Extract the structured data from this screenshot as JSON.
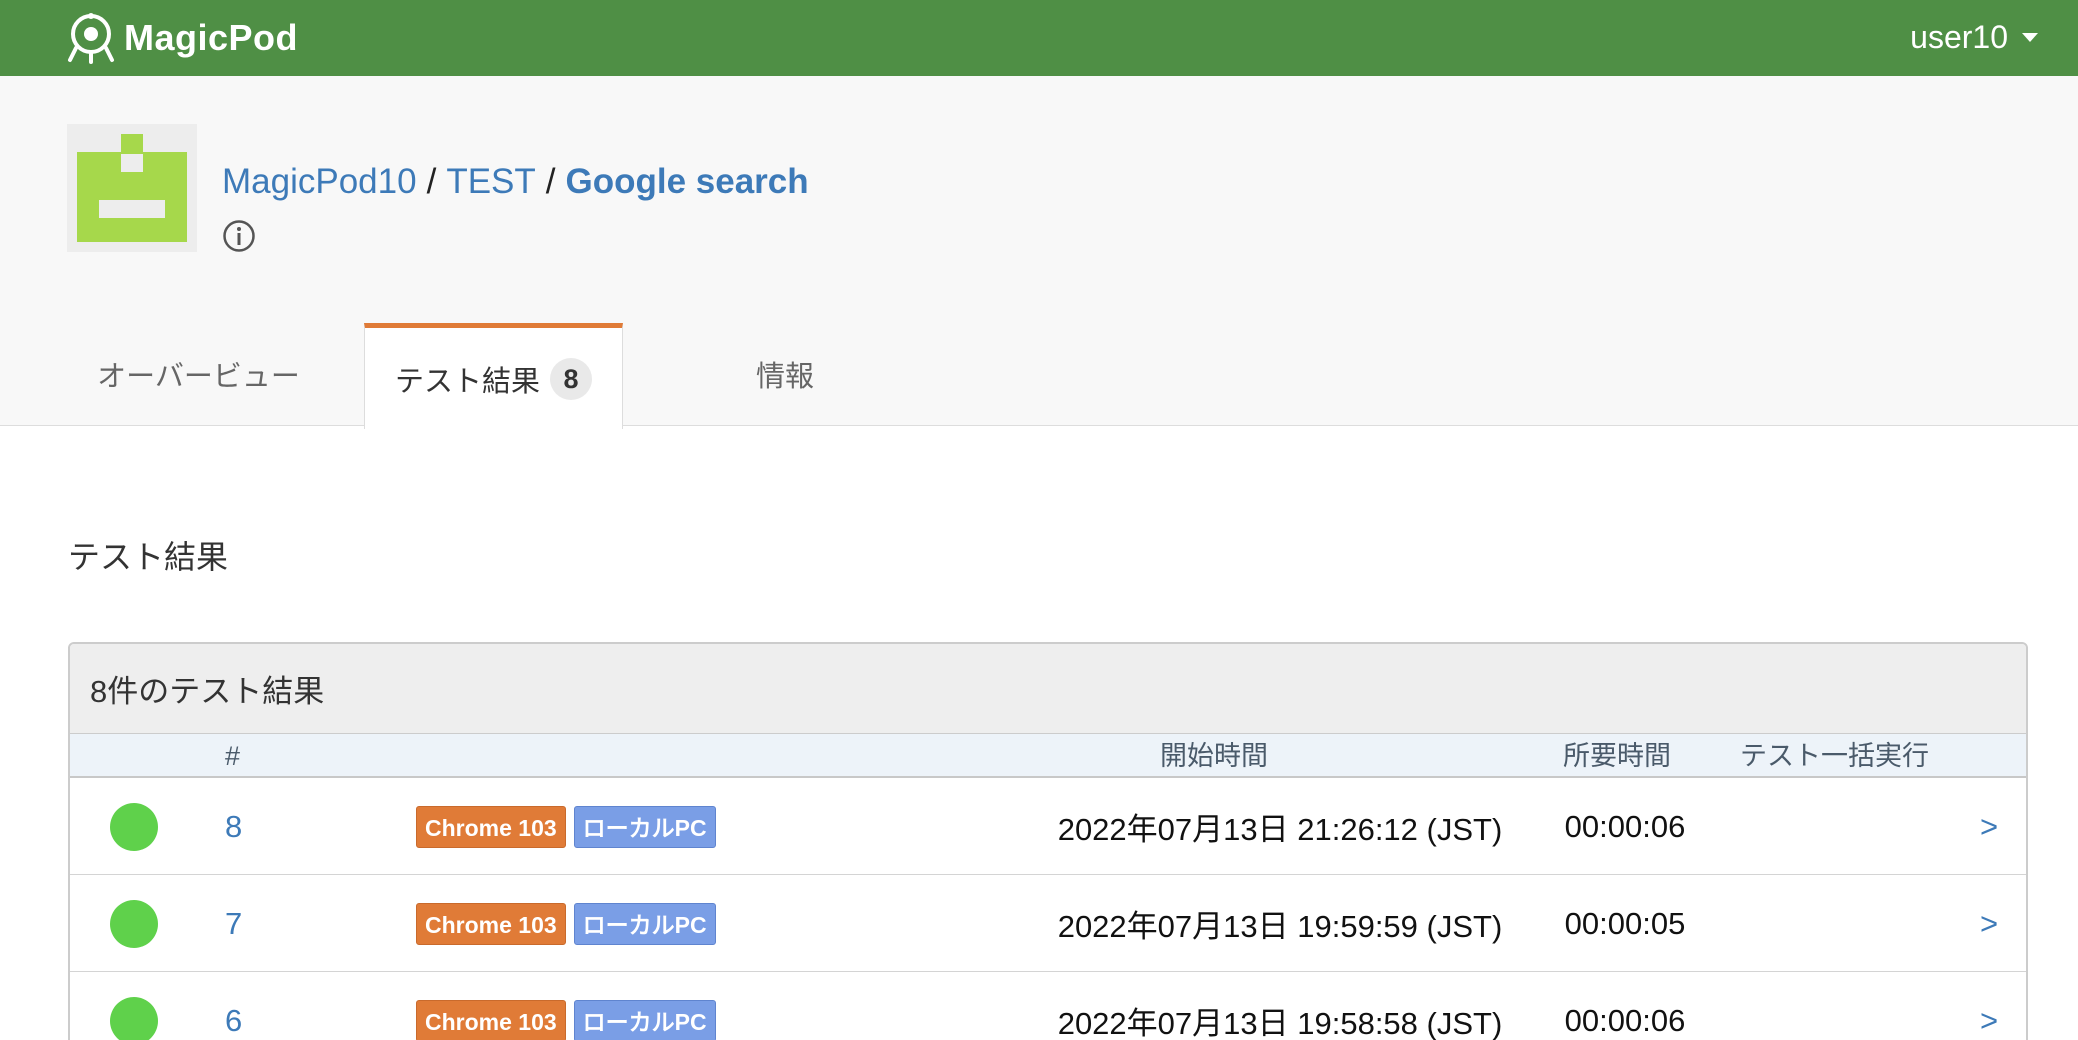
{
  "navbar": {
    "brand": "MagicPod",
    "user": "user10"
  },
  "breadcrumb": {
    "org": "MagicPod10",
    "project": "TEST",
    "current": "Google search",
    "separator": "/"
  },
  "tabs": {
    "overview": "オーバービュー",
    "results": "テスト結果",
    "results_count": "8",
    "info": "情報"
  },
  "section_title": "テスト結果",
  "panel": {
    "heading": "8件のテスト結果",
    "columns": {
      "number": "#",
      "start_time": "開始時間",
      "duration": "所要時間",
      "batch_run": "テスト一括実行"
    },
    "rows": [
      {
        "number": "8",
        "browser": "Chrome 103",
        "environment": "ローカルPC",
        "start_time": "2022年07月13日 21:26:12 (JST)",
        "duration": "00:00:06",
        "arrow": ">",
        "status": "success"
      },
      {
        "number": "7",
        "browser": "Chrome 103",
        "environment": "ローカルPC",
        "start_time": "2022年07月13日 19:59:59 (JST)",
        "duration": "00:00:05",
        "arrow": ">",
        "status": "success"
      },
      {
        "number": "6",
        "browser": "Chrome 103",
        "environment": "ローカルPC",
        "start_time": "2022年07月13日 19:58:58 (JST)",
        "duration": "00:00:06",
        "arrow": ">",
        "status": "success"
      }
    ]
  },
  "colors": {
    "navbar": "#4f8f45",
    "tab_active_border": "#e07b37",
    "link": "#3d7ab8",
    "status_success": "#5fd14b",
    "badge_browser": "#e07b37",
    "badge_env": "#7a9ee6",
    "avatar_fill": "#a6d84b"
  },
  "icons": {
    "brand": "magicpod-logo-icon",
    "user_menu": "caret-down-icon",
    "info": "info-circle-icon",
    "status": "success-dot-icon"
  }
}
